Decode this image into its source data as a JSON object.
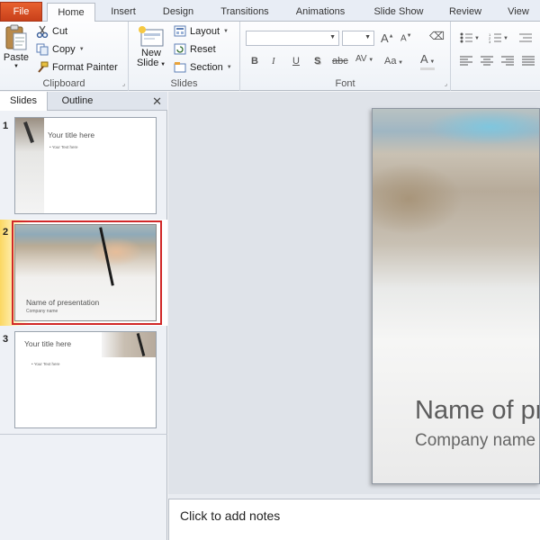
{
  "tabs": [
    "File",
    "Home",
    "Insert",
    "Design",
    "Transitions",
    "Animations",
    "Slide Show",
    "Review",
    "View"
  ],
  "active_tab": "Home",
  "clipboard": {
    "paste": "Paste",
    "cut": "Cut",
    "copy": "Copy",
    "format_painter": "Format Painter",
    "label": "Clipboard"
  },
  "slides_group": {
    "new_slide_line1": "New",
    "new_slide_line2": "Slide",
    "layout": "Layout",
    "reset": "Reset",
    "section": "Section",
    "label": "Slides"
  },
  "font_group": {
    "label": "Font",
    "font_name": "",
    "font_size": "",
    "bold": "B",
    "italic": "I",
    "underline": "U",
    "shadow": "S",
    "strike": "abc",
    "spacing": "AV",
    "case": "Aa",
    "color": "A"
  },
  "panel": {
    "tab_slides": "Slides",
    "tab_outline": "Outline",
    "close": "✕"
  },
  "thumbnails": [
    {
      "num": "1",
      "title": "Your title here",
      "bullet": "• Your Text here"
    },
    {
      "num": "2",
      "title": "Name of presentation",
      "subtitle": "Company name"
    },
    {
      "num": "3",
      "title": "Your title here",
      "bullet": "• Your Text here"
    }
  ],
  "slide": {
    "title": "Name of presentation",
    "subtitle": "Company name"
  },
  "notes": {
    "placeholder": "Click to add notes"
  },
  "colors": {
    "file_tab": "#d9512c",
    "selection": "#d12828",
    "selection_glow": "#fbd862"
  }
}
